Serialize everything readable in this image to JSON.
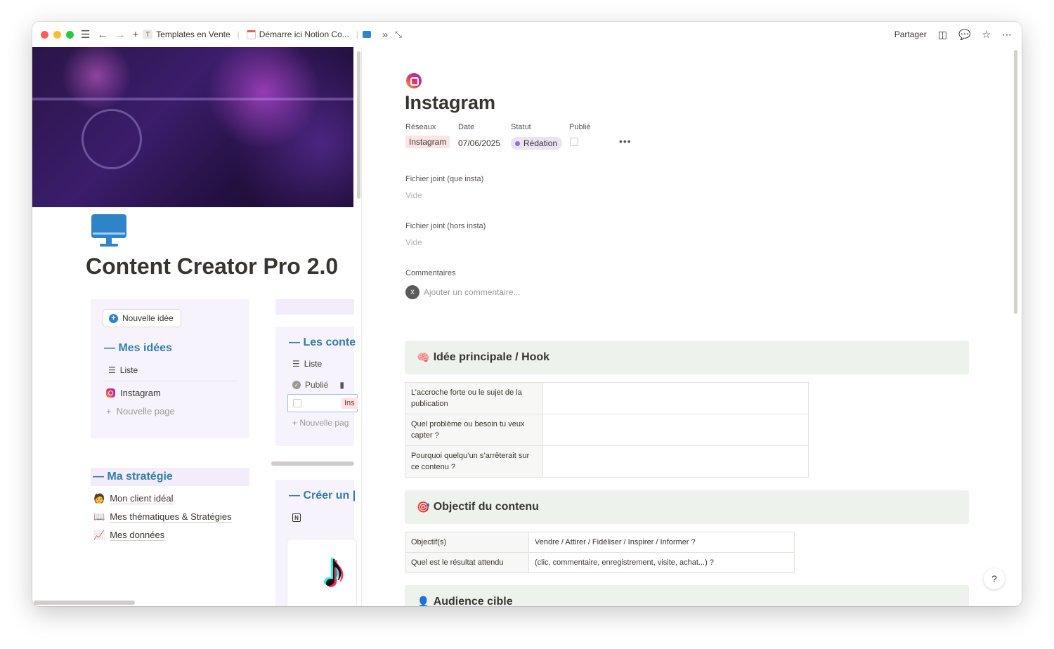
{
  "topbar": {
    "crumbs": [
      {
        "icon": "T",
        "label": "Templates en Vente"
      },
      {
        "label": "Démarre ici Notion Co..."
      }
    ],
    "share_label": "Partager"
  },
  "left": {
    "title": "Content Creator Pro 2.0",
    "ideas": {
      "new_button": "Nouvelle idée",
      "heading": "— Mes idées",
      "view": "Liste",
      "items": [
        "Instagram"
      ],
      "new_page": "Nouvelle page"
    },
    "contents": {
      "heading": "— Les conte",
      "view": "Liste",
      "column": "Publié",
      "tag": "Ins",
      "new_page": "Nouvelle pag"
    },
    "strategy": {
      "heading": "— Ma stratégie",
      "items": [
        {
          "emoji": "🧑",
          "label": "Mon client idéal"
        },
        {
          "emoji": "📖",
          "label": "Mes thématiques & Stratégies"
        },
        {
          "emoji": "📈",
          "label": "Mes données"
        }
      ]
    },
    "create": {
      "heading": "— Créer un |"
    }
  },
  "page": {
    "title": "Instagram",
    "properties": {
      "reseaux_label": "Réseaux",
      "reseaux_value": "Instagram",
      "date_label": "Date",
      "date_value": "07/06/2025",
      "statut_label": "Statut",
      "statut_value": "Rédation",
      "publie_label": "Publié",
      "publie_checked": false
    },
    "files": [
      {
        "label": "Fichier joint (que insta)",
        "value": "Vide"
      },
      {
        "label": "Fichier joint (hors insta)",
        "value": "Vide"
      }
    ],
    "comments_label": "Commentaires",
    "avatar_initial": "X",
    "comment_placeholder": "Ajouter un commentaire...",
    "sections": [
      {
        "emoji": "🧠",
        "title": "Idée principale / Hook"
      },
      {
        "emoji": "🎯",
        "title": "Objectif du contenu"
      },
      {
        "emoji": "👤",
        "title": "Audience cible"
      }
    ],
    "hook_rows": [
      {
        "q": "L’accroche forte ou le sujet de la publication",
        "a": ""
      },
      {
        "q": "Quel problème ou besoin tu veux capter ?",
        "a": ""
      },
      {
        "q": "Pourquoi quelqu’un s’arrêterait sur ce contenu ?",
        "a": ""
      }
    ],
    "objective_rows": [
      {
        "q": "Objectif(s)",
        "a": "Vendre / Attirer / Fidéliser / Inspirer / Informer ?"
      },
      {
        "q": "Quel est le résultat attendu",
        "a": "(clic, commentaire, enregistrement, visite, achat...) ?"
      }
    ]
  },
  "colors": {
    "accent_blue": "#337ea9",
    "section_bg": "#edf3ec",
    "card_bg": "#f7f3fc",
    "tag_red_bg": "#fbe4e4",
    "status_purple": "#9a6dd7"
  }
}
